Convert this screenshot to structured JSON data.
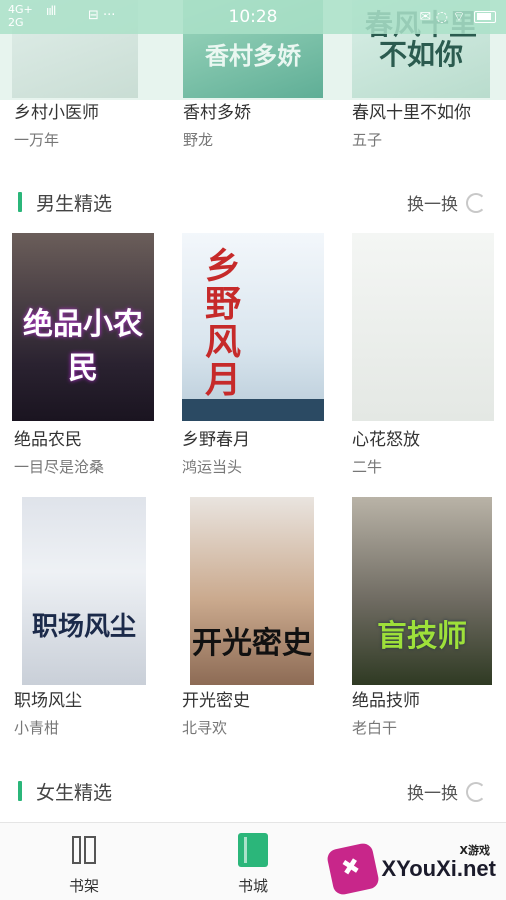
{
  "status_bar": {
    "network_top": "4G+",
    "network_bottom": "2G",
    "signal": "ııll",
    "extra": "⊟ ···",
    "time": "10:28",
    "right_icons": "✉ ◌ ⌔"
  },
  "top_banner": {
    "covers": [
      {
        "title": "",
        "color": "#c9ddd4"
      },
      {
        "title": "香村多娇",
        "color": "#5fae96"
      },
      {
        "title": "春风十里不如你",
        "color": "#b9dccd"
      }
    ],
    "books": [
      {
        "title": "乡村小医师",
        "author": "一万年"
      },
      {
        "title": "香村多娇",
        "author": "野龙"
      },
      {
        "title": "春风十里不如你",
        "author": "五子"
      }
    ]
  },
  "male_section": {
    "label": "男生精选",
    "refresh_label": "换一换",
    "books": [
      {
        "title": "绝品农民",
        "author": "一目尽是沧桑",
        "cover_text": "绝品小农民"
      },
      {
        "title": "乡野春月",
        "author": "鸿运当头",
        "cover_text": "乡野风月"
      },
      {
        "title": "心花怒放",
        "author": "二牛",
        "cover_text": ""
      },
      {
        "title": "职场风尘",
        "author": "小青柑",
        "cover_text": "职场风尘"
      },
      {
        "title": "开光密史",
        "author": "北寻欢",
        "cover_text": "开光密史"
      },
      {
        "title": "绝品技师",
        "author": "老白干",
        "cover_text": "盲技师"
      }
    ]
  },
  "female_section": {
    "label": "女生精选",
    "refresh_label": "换一换"
  },
  "tabbar": {
    "tabs": [
      {
        "label": "书架",
        "icon": "bookshelf-icon"
      },
      {
        "label": "书城",
        "icon": "bookstore-icon",
        "active": true
      }
    ]
  },
  "watermark": {
    "small": "X游戏",
    "text": "XYouXi.net"
  },
  "colors": {
    "accent": "#2bb67a",
    "status_bar": "#aae1c8"
  }
}
